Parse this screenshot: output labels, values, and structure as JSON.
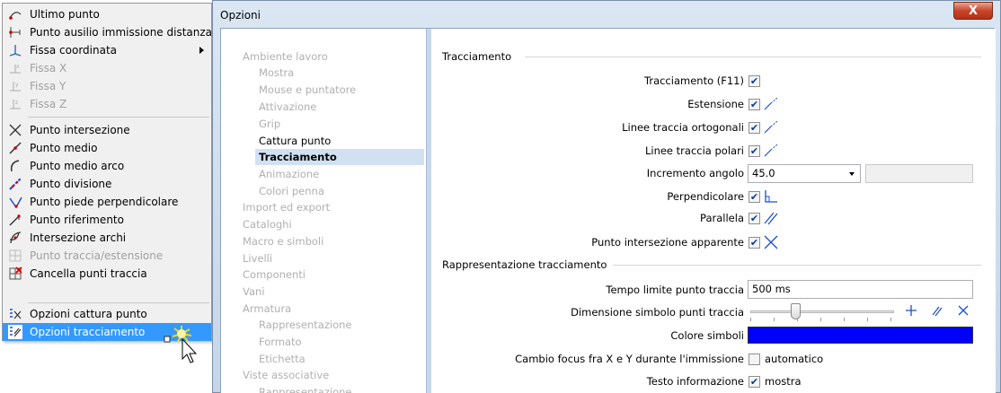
{
  "menu": {
    "items": [
      {
        "label": "Ultimo punto",
        "icon": "last-point-icon",
        "disabled": false
      },
      {
        "label": "Punto ausilio immissione distanza",
        "icon": "distance-point-icon",
        "disabled": false
      },
      {
        "label": "Fissa coordinata",
        "icon": "fix-coordinate-icon",
        "disabled": false,
        "submenu": true
      },
      {
        "label": "Fissa X",
        "icon": "fix-x-icon",
        "disabled": true
      },
      {
        "label": "Fissa Y",
        "icon": "fix-y-icon",
        "disabled": true
      },
      {
        "label": "Fissa Z",
        "icon": "fix-z-icon",
        "disabled": true
      },
      {
        "label": "Punto intersezione",
        "icon": "intersection-point-icon",
        "disabled": false
      },
      {
        "label": "Punto medio",
        "icon": "midpoint-icon",
        "disabled": false
      },
      {
        "label": "Punto medio arco",
        "icon": "arc-midpoint-icon",
        "disabled": false
      },
      {
        "label": "Punto divisione",
        "icon": "division-point-icon",
        "disabled": false
      },
      {
        "label": "Punto piede perpendicolare",
        "icon": "perpendicular-foot-icon",
        "disabled": false
      },
      {
        "label": "Punto riferimento",
        "icon": "reference-point-icon",
        "disabled": false
      },
      {
        "label": "Intersezione archi",
        "icon": "arc-intersection-icon",
        "disabled": false
      },
      {
        "label": "Punto traccia/estensione",
        "icon": "track-point-icon",
        "disabled": true
      },
      {
        "label": "Cancella punti traccia",
        "icon": "delete-track-points-icon",
        "disabled": false
      },
      {
        "label": "Opzioni cattura punto",
        "icon": "snap-options-icon",
        "disabled": false
      },
      {
        "label": "Opzioni tracciamento",
        "icon": "tracking-options-icon",
        "disabled": false,
        "selected": true
      }
    ]
  },
  "dialog": {
    "title": "Opzioni",
    "close_label": "X"
  },
  "tree": {
    "nodes": [
      {
        "label": "Ambiente lavoro",
        "level": 0,
        "state": "dim"
      },
      {
        "label": "Mostra",
        "level": 1,
        "state": "dim"
      },
      {
        "label": "Mouse e puntatore",
        "level": 1,
        "state": "dim"
      },
      {
        "label": "Attivazione",
        "level": 1,
        "state": "dim"
      },
      {
        "label": "Grip",
        "level": 1,
        "state": "dim"
      },
      {
        "label": "Cattura punto",
        "level": 1,
        "state": "active"
      },
      {
        "label": "Tracciamento",
        "level": 1,
        "state": "current"
      },
      {
        "label": "Animazione",
        "level": 1,
        "state": "dim"
      },
      {
        "label": "Colori penna",
        "level": 1,
        "state": "dim"
      },
      {
        "label": "Import ed export",
        "level": 0,
        "state": "dim"
      },
      {
        "label": "Cataloghi",
        "level": 0,
        "state": "dim"
      },
      {
        "label": "Macro e simboli",
        "level": 0,
        "state": "dim"
      },
      {
        "label": "Livelli",
        "level": 0,
        "state": "dim"
      },
      {
        "label": "Componenti",
        "level": 0,
        "state": "dim"
      },
      {
        "label": "Vani",
        "level": 0,
        "state": "dim"
      },
      {
        "label": "Armatura",
        "level": 0,
        "state": "dim"
      },
      {
        "label": "Rappresentazione",
        "level": 1,
        "state": "dim"
      },
      {
        "label": "Formato",
        "level": 1,
        "state": "dim"
      },
      {
        "label": "Etichetta",
        "level": 1,
        "state": "dim"
      },
      {
        "label": "Viste associative",
        "level": 0,
        "state": "dim"
      },
      {
        "label": "Rappresentazione",
        "level": 1,
        "state": "dim"
      }
    ]
  },
  "tracking": {
    "group_title": "Tracciamento",
    "rows": [
      {
        "label": "Tracciamento (F11)",
        "checked": true,
        "symbol": ""
      },
      {
        "label": "Estensione",
        "checked": true,
        "symbol": "extension-line-icon"
      },
      {
        "label": "Linee traccia ortogonali",
        "checked": true,
        "symbol": "orthogonal-track-icon"
      },
      {
        "label": "Linee traccia polari",
        "checked": true,
        "symbol": "polar-track-icon"
      },
      {
        "label": "Incremento angolo",
        "value": "45.0"
      },
      {
        "label": "Perpendicolare",
        "checked": true,
        "symbol": "perpendicular-icon"
      },
      {
        "label": "Parallela",
        "checked": true,
        "symbol": "parallel-icon"
      },
      {
        "label": "Punto intersezione apparente",
        "checked": true,
        "symbol": "apparent-intersection-icon"
      }
    ]
  },
  "representation": {
    "group_title": "Rappresentazione tracciamento",
    "time_limit_label": "Tempo limite punto traccia",
    "time_limit_value": "500 ms",
    "symbol_size_label": "Dimensione simbolo punti traccia",
    "symbol_size_fraction": 0.3,
    "symbol_color_label": "Colore simboli",
    "symbol_color": "#0000ff",
    "focus_label": "Cambio focus fra X e Y durante l'immissione",
    "focus_checked": false,
    "focus_text": "automatico",
    "info_label": "Testo informazione",
    "info_checked": true,
    "info_text": "mostra"
  }
}
